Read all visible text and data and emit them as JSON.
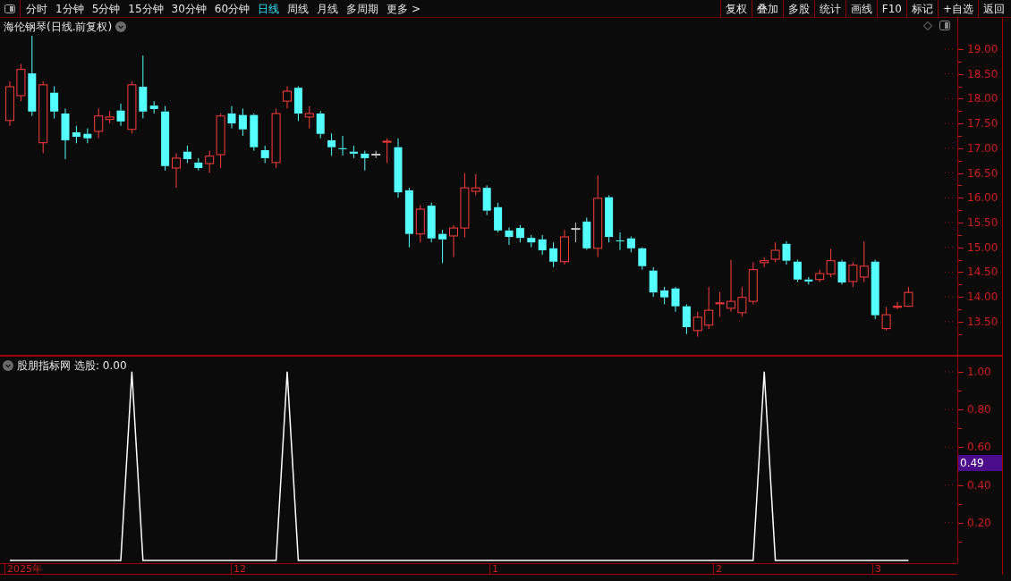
{
  "toolbar": {
    "periods": [
      {
        "label": "分时",
        "selected": false
      },
      {
        "label": "1分钟",
        "selected": false
      },
      {
        "label": "5分钟",
        "selected": false
      },
      {
        "label": "15分钟",
        "selected": false
      },
      {
        "label": "30分钟",
        "selected": false
      },
      {
        "label": "60分钟",
        "selected": false
      },
      {
        "label": "日线",
        "selected": true
      },
      {
        "label": "周线",
        "selected": false
      },
      {
        "label": "月线",
        "selected": false
      },
      {
        "label": "多周期",
        "selected": false
      },
      {
        "label": "更多 >",
        "selected": false
      }
    ],
    "actions": [
      "复权",
      "叠加",
      "多股",
      "统计",
      "画线",
      "F10",
      "标记",
      "+自选",
      "返回"
    ]
  },
  "price_pane": {
    "title": "海伦钢琴(日线.前复权)",
    "chart_data": {
      "type": "candlestick",
      "ylim": [
        12.83,
        19.63
      ],
      "yticks": [
        {
          "value": 13.5,
          "label": "13.50"
        },
        {
          "value": 14,
          "label": "14.00"
        },
        {
          "value": 14.5,
          "label": "14.50"
        },
        {
          "value": 15,
          "label": "15.00"
        },
        {
          "value": 15.5,
          "label": "15.50"
        },
        {
          "value": 16,
          "label": "16.00"
        },
        {
          "value": 16.5,
          "label": "16.50"
        },
        {
          "value": 17,
          "label": "17.00"
        },
        {
          "value": 17.5,
          "label": "17.50"
        },
        {
          "value": 18,
          "label": "18.00"
        },
        {
          "value": 18.5,
          "label": "18.50"
        },
        {
          "value": 19,
          "label": "19.00"
        }
      ],
      "ohlc": [
        [
          17.56,
          18.35,
          17.45,
          18.24
        ],
        [
          18.06,
          18.7,
          17.95,
          18.59
        ],
        [
          18.51,
          19.27,
          17.65,
          17.74
        ],
        [
          17.11,
          18.35,
          16.9,
          18.28
        ],
        [
          18.12,
          18.25,
          17.6,
          17.74
        ],
        [
          17.7,
          17.8,
          16.78,
          17.16
        ],
        [
          17.32,
          17.45,
          17.1,
          17.23
        ],
        [
          17.29,
          17.4,
          17.1,
          17.2
        ],
        [
          17.34,
          17.8,
          17.2,
          17.65
        ],
        [
          17.58,
          17.75,
          17.5,
          17.63
        ],
        [
          17.76,
          17.9,
          17.45,
          17.54
        ],
        [
          17.38,
          18.35,
          17.3,
          18.28
        ],
        [
          18.24,
          18.87,
          17.6,
          17.74
        ],
        [
          17.86,
          17.95,
          17.7,
          17.79
        ],
        [
          17.74,
          17.85,
          16.55,
          16.64
        ],
        [
          16.6,
          16.9,
          16.2,
          16.8
        ],
        [
          16.93,
          17.05,
          16.7,
          16.78
        ],
        [
          16.71,
          16.8,
          16.55,
          16.6
        ],
        [
          16.69,
          16.95,
          16.5,
          16.84
        ],
        [
          16.87,
          17.7,
          16.6,
          17.65
        ],
        [
          17.7,
          17.85,
          17.4,
          17.5
        ],
        [
          17.67,
          17.8,
          17.25,
          17.38
        ],
        [
          17.67,
          17.7,
          16.95,
          17.02
        ],
        [
          16.96,
          17.05,
          16.7,
          16.8
        ],
        [
          16.71,
          17.8,
          16.6,
          17.7
        ],
        [
          17.95,
          18.25,
          17.8,
          18.15
        ],
        [
          18.22,
          18.25,
          17.55,
          17.7
        ],
        [
          17.63,
          17.85,
          17.4,
          17.7
        ],
        [
          17.7,
          17.75,
          17.2,
          17.29
        ],
        [
          17.16,
          17.3,
          16.85,
          17.02
        ],
        [
          17,
          17.25,
          16.85,
          16.98
        ],
        [
          16.93,
          17.05,
          16.8,
          16.89
        ],
        [
          16.89,
          16.95,
          16.55,
          16.8
        ],
        [
          16.88,
          16.95,
          16.8,
          16.88
        ],
        [
          17.13,
          17.2,
          16.7,
          17.14
        ],
        [
          17.02,
          17.2,
          16,
          16.11
        ],
        [
          16.15,
          16.2,
          15,
          15.27
        ],
        [
          15.27,
          15.85,
          15.1,
          15.77
        ],
        [
          15.84,
          15.9,
          15.1,
          15.18
        ],
        [
          15.27,
          15.35,
          14.68,
          15.16
        ],
        [
          15.23,
          15.45,
          14.8,
          15.39
        ],
        [
          15.39,
          16.5,
          15.2,
          16.2
        ],
        [
          16.13,
          16.48,
          16.05,
          16.2
        ],
        [
          16.2,
          16.25,
          15.65,
          15.74
        ],
        [
          15.81,
          15.9,
          15.3,
          15.34
        ],
        [
          15.34,
          15.4,
          15.05,
          15.21
        ],
        [
          15.39,
          15.45,
          15.1,
          15.19
        ],
        [
          15.19,
          15.25,
          15,
          15.1
        ],
        [
          15.16,
          15.25,
          14.85,
          14.94
        ],
        [
          14.98,
          15.1,
          14.6,
          14.71
        ],
        [
          14.71,
          15.35,
          14.65,
          15.21
        ],
        [
          15.38,
          15.5,
          15.1,
          15.38
        ],
        [
          15.52,
          15.6,
          14.95,
          14.98
        ],
        [
          14.98,
          16.45,
          14.8,
          15.99
        ],
        [
          16.01,
          16.05,
          15.1,
          15.21
        ],
        [
          15.14,
          15.3,
          14.95,
          15.12
        ],
        [
          15.18,
          15.22,
          14.9,
          14.98
        ],
        [
          14.98,
          15,
          14.55,
          14.62
        ],
        [
          14.53,
          14.6,
          14,
          14.09
        ],
        [
          14.13,
          14.2,
          13.85,
          13.99
        ],
        [
          14.17,
          14.2,
          13.7,
          13.81
        ],
        [
          13.81,
          13.85,
          13.25,
          13.39
        ],
        [
          13.32,
          13.7,
          13.2,
          13.59
        ],
        [
          13.43,
          14.2,
          13.35,
          13.73
        ],
        [
          13.86,
          14.1,
          13.6,
          13.88
        ],
        [
          13.77,
          14.75,
          13.7,
          13.91
        ],
        [
          13.68,
          14.2,
          13.6,
          13.99
        ],
        [
          13.91,
          14.7,
          13.85,
          14.55
        ],
        [
          14.69,
          14.8,
          14.6,
          14.73
        ],
        [
          14.76,
          15.1,
          14.7,
          14.94
        ],
        [
          15.07,
          15.12,
          14.65,
          14.73
        ],
        [
          14.71,
          14.75,
          14.3,
          14.35
        ],
        [
          14.35,
          14.4,
          14.25,
          14.31
        ],
        [
          14.35,
          14.55,
          14.3,
          14.47
        ],
        [
          14.46,
          14.97,
          14.4,
          14.73
        ],
        [
          14.71,
          14.75,
          14.25,
          14.29
        ],
        [
          14.31,
          14.7,
          14.2,
          14.64
        ],
        [
          14.4,
          15.12,
          14.3,
          14.62
        ],
        [
          14.71,
          14.75,
          13.55,
          13.63
        ],
        [
          13.36,
          13.8,
          13.32,
          13.64
        ],
        [
          13.79,
          13.9,
          13.75,
          13.81
        ],
        [
          13.81,
          14.2,
          13.8,
          14.09
        ]
      ]
    }
  },
  "indicator_pane": {
    "name": "股朋指标网",
    "value": "选股: 0.00",
    "cursor_label": "0.49",
    "date_axis": [
      {
        "label": "2025年"
      },
      {
        "label": "12"
      },
      {
        "label": "1"
      },
      {
        "label": "2"
      },
      {
        "label": "3"
      }
    ],
    "chart_data": {
      "type": "line",
      "ylim": [
        -0.014,
        1.08
      ],
      "yticks": [
        {
          "value": 0.2,
          "label": "0.20"
        },
        {
          "value": 0.4,
          "label": "0.40"
        },
        {
          "value": 0.6,
          "label": "0.60"
        },
        {
          "value": 0.8,
          "label": "0.80"
        },
        {
          "value": 1,
          "label": "1.00"
        }
      ],
      "series": [
        {
          "color": "#ffffff",
          "values": [
            0,
            0,
            0,
            0,
            0,
            0,
            0,
            0,
            0,
            0,
            0,
            1,
            0,
            0,
            0,
            0,
            0,
            0,
            0,
            0,
            0,
            0,
            0,
            0,
            0,
            1,
            0,
            0,
            0,
            0,
            0,
            0,
            0,
            0,
            0,
            0,
            0,
            0,
            0,
            0,
            0,
            0,
            0,
            0,
            0,
            0,
            0,
            0,
            0,
            0,
            0,
            0,
            0,
            0,
            0,
            0,
            0,
            0,
            0,
            0,
            0,
            0,
            0,
            0,
            0,
            0,
            0,
            0,
            1,
            0,
            0,
            0,
            0,
            0,
            0,
            0,
            0,
            0,
            0,
            0,
            0,
            0
          ]
        }
      ]
    }
  }
}
